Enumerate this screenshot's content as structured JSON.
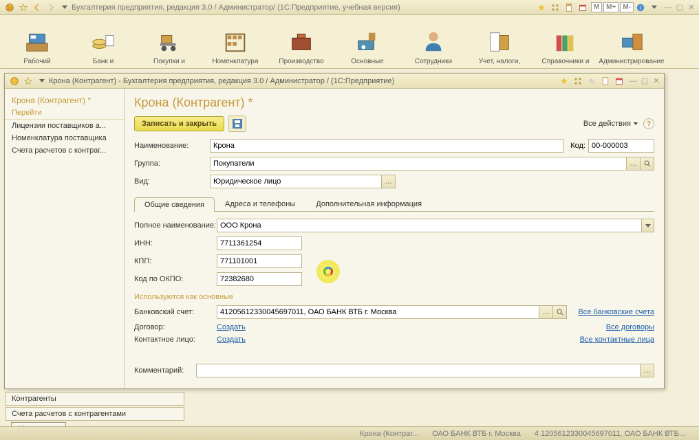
{
  "outer_title": "Бухгалтерия предприятия, редакция 3.0 / Администратор/   (1С:Предприятие, учебная версия)",
  "btn_m": "M",
  "btn_mplus": "M+",
  "btn_mminus": "M-",
  "toolbar": [
    {
      "label": "Рабочий"
    },
    {
      "label": "Банк и"
    },
    {
      "label": "Покупки и"
    },
    {
      "label": "Номенклатура"
    },
    {
      "label": "Производство"
    },
    {
      "label": "Основные"
    },
    {
      "label": "Сотрудники"
    },
    {
      "label": "Учет, налоги,"
    },
    {
      "label": "Справочники и"
    },
    {
      "label": "Администрирование"
    }
  ],
  "child_title": "Крона (Контрагент) - Бухгалтерия предприятия, редакция 3.0 / Администратор /   (1С:Предприятие)",
  "left_panel": {
    "title": "Крона (Контрагент) *",
    "nav_link": "Перейти",
    "items": [
      "Лицензии поставщиков а...",
      "Номенклатура поставщика",
      "Счета расчетов с контраг..."
    ]
  },
  "content": {
    "title": "Крона (Контрагент) *",
    "save_close": "Записать и закрыть",
    "all_actions": "Все действия",
    "help": "?",
    "labels": {
      "name": "Наименование:",
      "code": "Код:",
      "group": "Группа:",
      "type": "Вид:",
      "full_name": "Полное наименование:",
      "inn": "ИНН:",
      "kpp": "КПП:",
      "okpo": "Код по ОКПО:",
      "section": "Используются как основные",
      "bank": "Банковский счет:",
      "contract": "Договор:",
      "contact": "Контактное лицо:",
      "comment": "Комментарий:"
    },
    "values": {
      "name": "Крона",
      "code": "00-000003",
      "group": "Покупатели",
      "type": "Юридическое лицо",
      "full_name": "ООО Крона",
      "inn": "7711361254",
      "kpp": "771101001",
      "okpo": "72382680",
      "bank": "41205612330045697011, ОАО БАНК ВТБ г. Москва",
      "comment": ""
    },
    "tabs": [
      "Общие сведения",
      "Адреса и телефоны",
      "Дополнительная информация"
    ],
    "links": {
      "create": "Создать",
      "all_bank": "Все банковские счета",
      "all_contracts": "Все договоры",
      "all_contacts": "Все контактные лица"
    }
  },
  "lower_items": [
    "Контрагенты",
    "Счета расчетов с контрагентами"
  ],
  "history_btn": "История...",
  "status_entries": [
    "Крона (Контраг...",
    "ОАО БАНК ВТБ г. Москва",
    "4 1205612330045697011, ОАО БАНК ВТБ..."
  ]
}
